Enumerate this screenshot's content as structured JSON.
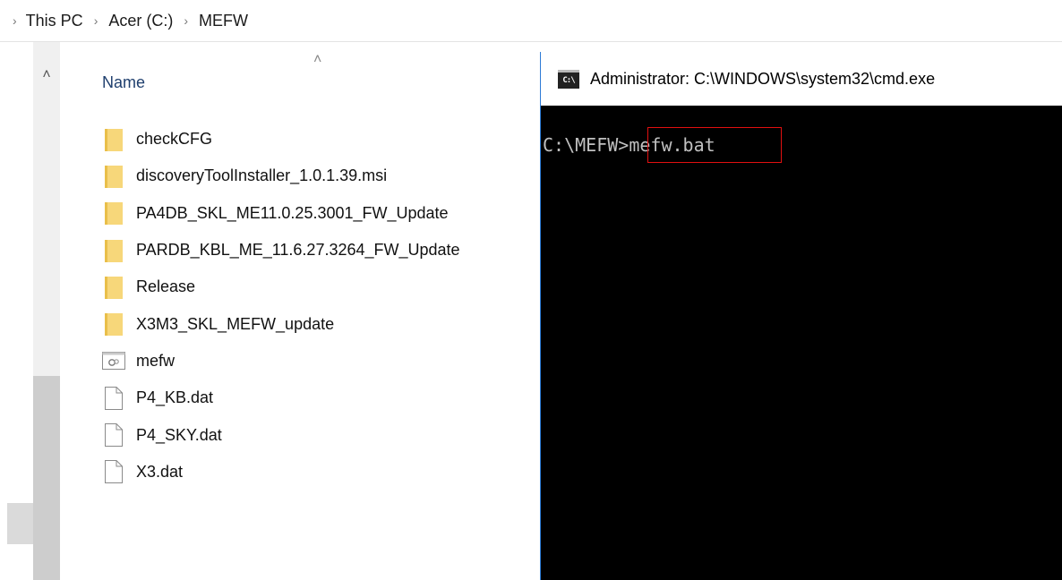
{
  "breadcrumb": {
    "items": [
      "This PC",
      "Acer (C:)",
      "MEFW"
    ]
  },
  "file_list": {
    "column_header": "Name",
    "items": [
      {
        "name": "checkCFG",
        "type": "folder"
      },
      {
        "name": "discoveryToolInstaller_1.0.1.39.msi",
        "type": "folder"
      },
      {
        "name": "PA4DB_SKL_ME11.0.25.3001_FW_Update",
        "type": "folder"
      },
      {
        "name": "PARDB_KBL_ME_11.6.27.3264_FW_Update",
        "type": "folder"
      },
      {
        "name": "Release",
        "type": "folder"
      },
      {
        "name": "X3M3_SKL_MEFW_update",
        "type": "folder"
      },
      {
        "name": "mefw",
        "type": "batch-file"
      },
      {
        "name": "P4_KB.dat",
        "type": "file"
      },
      {
        "name": "P4_SKY.dat",
        "type": "file"
      },
      {
        "name": "X3.dat",
        "type": "file"
      }
    ]
  },
  "cmd": {
    "icon_text": "C:\\",
    "title": "Administrator: C:\\WINDOWS\\system32\\cmd.exe",
    "prompt": "C:\\MEFW>",
    "command": "mefw.bat"
  },
  "colors": {
    "folder": "#f7d77a",
    "highlight": "#e21010",
    "cmd_background": "#000000",
    "cmd_text": "#c0c0c0"
  }
}
